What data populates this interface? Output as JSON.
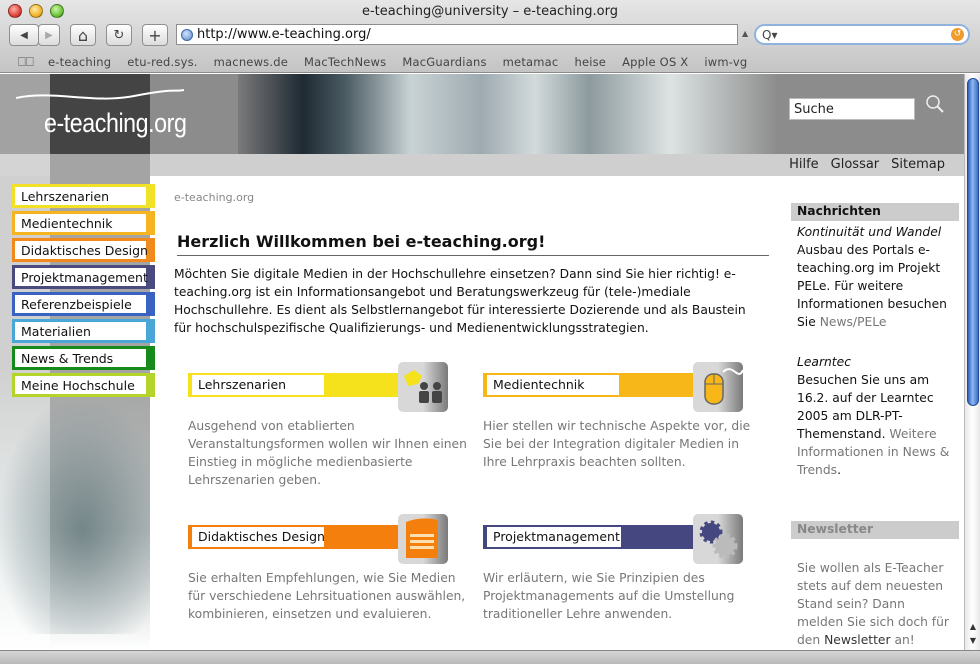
{
  "window": {
    "title": "e-teaching@university – e-teaching.org"
  },
  "toolbar": {
    "back_icon": "◀",
    "forward_icon": "▶",
    "home_icon": "⌂",
    "reload_icon": "↻",
    "add_icon": "+",
    "url": "http://www.e-teaching.org/",
    "search_placeholder": "Q▾",
    "snapback_icon": "↺"
  },
  "bookmarks": {
    "book_icon": "📖",
    "items": [
      "e-teaching",
      "etu-red.sys.",
      "macnews.de",
      "MacTechNews",
      "MacGuardians",
      "metamac",
      "heise",
      "Apple OS X",
      "iwm-vg"
    ]
  },
  "header": {
    "logo": "e-teaching.org",
    "search_value": "Suche",
    "links": [
      "Hilfe",
      "Glossar",
      "Sitemap"
    ]
  },
  "sidebar": {
    "items": [
      {
        "label": "Lehrszenarien",
        "color": "#f2e227"
      },
      {
        "label": "Medientechnik",
        "color": "#f5b421"
      },
      {
        "label": "Didaktisches Design",
        "color": "#f08a1c"
      },
      {
        "label": "Projektmanagement",
        "color": "#4a4a7e"
      },
      {
        "label": "Referenzbeispiele",
        "color": "#3a62c0"
      },
      {
        "label": "Materialien",
        "color": "#4aa6d6"
      },
      {
        "label": "News & Trends",
        "color": "#178a1c"
      },
      {
        "label": "Meine Hochschule",
        "color": "#b4d42c"
      }
    ]
  },
  "main": {
    "breadcrumb": "e-teaching.org",
    "title": "Herzlich Willkommen bei e-teaching.org!",
    "intro": "Möchten Sie digitale Medien in der Hochschullehre einsetzen? Dann sind Sie hier richtig! e-teaching.org ist ein Informationsangebot und Beratungswerkzeug für (tele-)mediale Hochschullehre. Es dient als Selbstlernangebot für interessierte Dozierende und als Baustein für hochschulspezifische Qualifizierungs- und Medienentwicklungsstrategien.",
    "teasers": [
      {
        "label": "Lehrszenarien",
        "color": "#f5e21c",
        "icon": "people-puzzle-icon",
        "text": "Ausgehend von etablierten Veranstaltungsformen wollen wir Ihnen einen Einstieg in mögliche medienbasierte Lehrszenarien geben."
      },
      {
        "label": "Medientechnik",
        "color": "#f7b718",
        "icon": "mouse-icon",
        "text": "Hier stellen wir technische Aspekte vor, die Sie bei der Integration digitaler Medien in Ihre Lehrpraxis beachten sollten."
      },
      {
        "label": "Didaktisches Design",
        "color": "#f57f0c",
        "icon": "document-icon",
        "text": "Sie erhalten Empfehlungen, wie Sie Medien für verschiedene Lehrsituationen auswählen, kombinieren, einsetzen und evaluieren."
      },
      {
        "label": "Projektmanagement",
        "color": "#454780",
        "icon": "gears-icon",
        "text": "Wir erläutern, wie Sie Prinzipien des Projektmanagements auf die Umstellung traditioneller Lehre anwenden."
      }
    ]
  },
  "news": {
    "heading": "Nachrichten",
    "items": [
      {
        "title": "Kontinuität und Wandel",
        "text": "Ausbau des Portals e-teaching.org im Projekt PELe. Für weitere Informationen besuchen Sie ",
        "link": "News/PELe",
        "tail": ""
      },
      {
        "title": "Learntec",
        "text": "Besuchen Sie uns am 16.2. auf der Learntec 2005 am DLR-PT-Themenstand. ",
        "link": "Weitere Informationen in News & Trends",
        "tail": "."
      }
    ]
  },
  "newsletter": {
    "heading": "Newsletter",
    "text": "Sie wollen als E-Teacher stets auf dem neuesten Stand sein? Dann melden Sie sich doch für den ",
    "link": "Newsletter",
    "tail": " an!"
  },
  "scrollbar": {
    "up_icon": "▲",
    "down_icon": "▼"
  }
}
